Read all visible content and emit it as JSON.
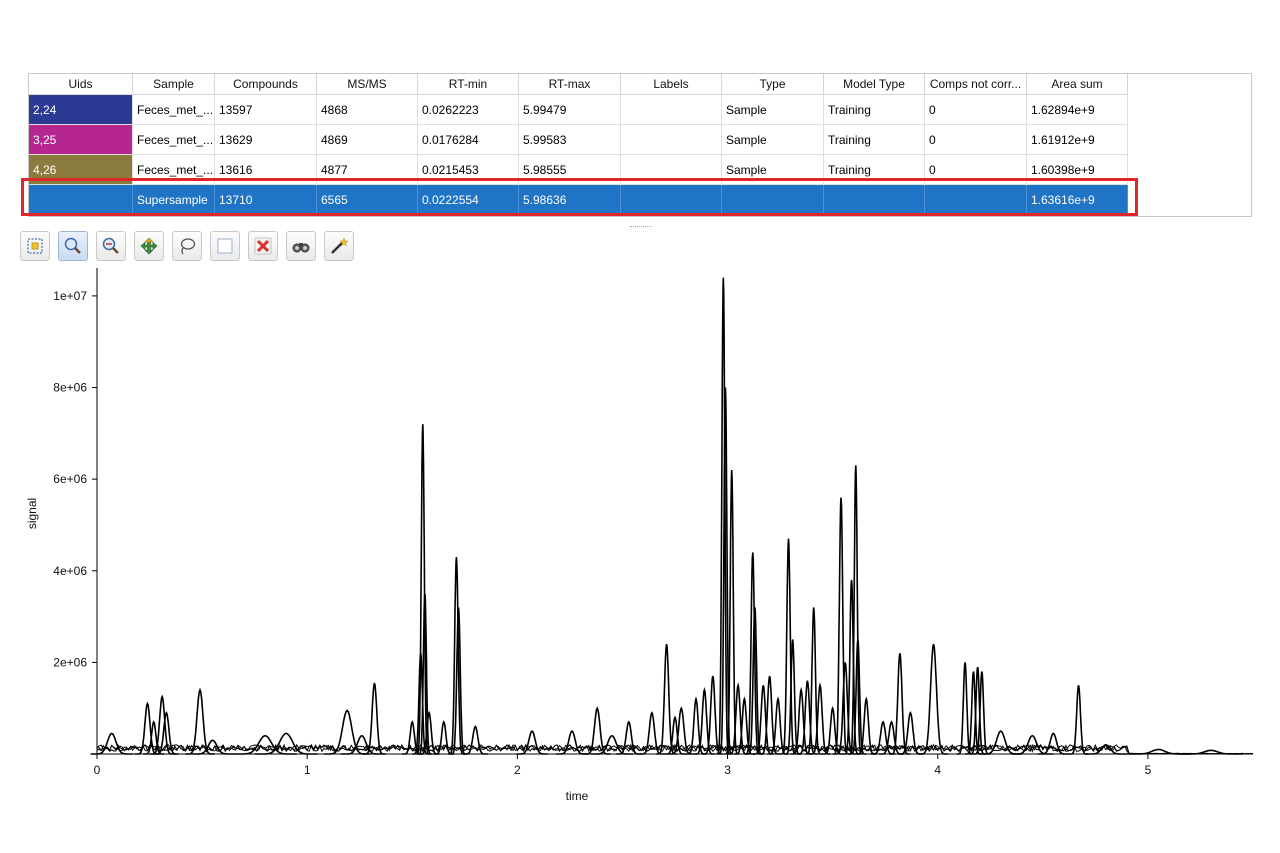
{
  "table": {
    "columns": [
      "Uids",
      "Sample",
      "Compounds",
      "MS/MS",
      "RT-min",
      "RT-max",
      "Labels",
      "Type",
      "Model Type",
      "Comps not corr...",
      "Area sum"
    ],
    "rows": [
      {
        "uids": "2,24",
        "color": "#2b3a93",
        "sample": "Feces_met_...",
        "compounds": "13597",
        "msms": "4868",
        "rt_min": "0.0262223",
        "rt_max": "5.99479",
        "labels": "",
        "type": "Sample",
        "model_type": "Training",
        "comps_not_corr": "0",
        "area_sum": "1.62894e+9"
      },
      {
        "uids": "3,25",
        "color": "#b5268f",
        "sample": "Feces_met_...",
        "compounds": "13629",
        "msms": "4869",
        "rt_min": "0.0176284",
        "rt_max": "5.99583",
        "labels": "",
        "type": "Sample",
        "model_type": "Training",
        "comps_not_corr": "0",
        "area_sum": "1.61912e+9"
      },
      {
        "uids": "4,26",
        "color": "#8b7b3c",
        "sample": "Feces_met_...",
        "compounds": "13616",
        "msms": "4877",
        "rt_min": "0.0215453",
        "rt_max": "5.98555",
        "labels": "",
        "type": "Sample",
        "model_type": "Training",
        "comps_not_corr": "0",
        "area_sum": "1.60398e+9"
      },
      {
        "uids": "",
        "color": "#1f74c6",
        "sample": "Supersample",
        "compounds": "13710",
        "msms": "6565",
        "rt_min": "0.0222554",
        "rt_max": "5.98636",
        "labels": "",
        "type": "",
        "model_type": "",
        "comps_not_corr": "",
        "area_sum": "1.63616e+9",
        "selected": true
      }
    ],
    "highlight_color": "#e0252b",
    "selection_color": "#1f74c6"
  },
  "toolbar": {
    "tools": [
      "select-box-icon",
      "zoom-in-icon",
      "zoom-out-icon",
      "pan-icon",
      "lasso-icon",
      "empty-square-icon",
      "delete-icon",
      "binoculars-icon",
      "magic-wand-icon"
    ]
  },
  "chart_data": {
    "type": "line",
    "xlabel": "time",
    "ylabel": "signal",
    "xlim": [
      0,
      5.5
    ],
    "ylim": [
      0,
      10500000
    ],
    "x_ticks": [
      "0",
      "1",
      "2",
      "3",
      "4",
      "5"
    ],
    "y_ticks": [
      "2e+06",
      "4e+06",
      "6e+06",
      "8e+06",
      "1e+07"
    ],
    "line_color": "#000000",
    "peaks": [
      {
        "rt": 0.07,
        "h": 450000,
        "w": 0.02
      },
      {
        "rt": 0.24,
        "h": 1100000,
        "w": 0.012
      },
      {
        "rt": 0.27,
        "h": 700000,
        "w": 0.01
      },
      {
        "rt": 0.31,
        "h": 1250000,
        "w": 0.012
      },
      {
        "rt": 0.33,
        "h": 900000,
        "w": 0.012
      },
      {
        "rt": 0.49,
        "h": 1400000,
        "w": 0.014
      },
      {
        "rt": 0.55,
        "h": 300000,
        "w": 0.02
      },
      {
        "rt": 0.8,
        "h": 400000,
        "w": 0.03
      },
      {
        "rt": 0.9,
        "h": 450000,
        "w": 0.03
      },
      {
        "rt": 1.19,
        "h": 950000,
        "w": 0.022
      },
      {
        "rt": 1.26,
        "h": 400000,
        "w": 0.02
      },
      {
        "rt": 1.32,
        "h": 1550000,
        "w": 0.011
      },
      {
        "rt": 1.5,
        "h": 700000,
        "w": 0.01
      },
      {
        "rt": 1.54,
        "h": 2200000,
        "w": 0.008
      },
      {
        "rt": 1.55,
        "h": 7200000,
        "w": 0.007
      },
      {
        "rt": 1.56,
        "h": 3500000,
        "w": 0.007
      },
      {
        "rt": 1.58,
        "h": 900000,
        "w": 0.01
      },
      {
        "rt": 1.65,
        "h": 700000,
        "w": 0.01
      },
      {
        "rt": 1.71,
        "h": 4300000,
        "w": 0.008
      },
      {
        "rt": 1.72,
        "h": 3200000,
        "w": 0.008
      },
      {
        "rt": 1.8,
        "h": 600000,
        "w": 0.012
      },
      {
        "rt": 2.07,
        "h": 500000,
        "w": 0.015
      },
      {
        "rt": 2.26,
        "h": 500000,
        "w": 0.015
      },
      {
        "rt": 2.38,
        "h": 1000000,
        "w": 0.013
      },
      {
        "rt": 2.45,
        "h": 400000,
        "w": 0.02
      },
      {
        "rt": 2.53,
        "h": 700000,
        "w": 0.012
      },
      {
        "rt": 2.64,
        "h": 900000,
        "w": 0.012
      },
      {
        "rt": 2.71,
        "h": 2400000,
        "w": 0.01
      },
      {
        "rt": 2.75,
        "h": 800000,
        "w": 0.01
      },
      {
        "rt": 2.78,
        "h": 1000000,
        "w": 0.012
      },
      {
        "rt": 2.85,
        "h": 1200000,
        "w": 0.01
      },
      {
        "rt": 2.89,
        "h": 1400000,
        "w": 0.01
      },
      {
        "rt": 2.93,
        "h": 1700000,
        "w": 0.01
      },
      {
        "rt": 2.98,
        "h": 10400000,
        "w": 0.007
      },
      {
        "rt": 2.99,
        "h": 8000000,
        "w": 0.007
      },
      {
        "rt": 3.02,
        "h": 6200000,
        "w": 0.007
      },
      {
        "rt": 3.05,
        "h": 1500000,
        "w": 0.01
      },
      {
        "rt": 3.08,
        "h": 1200000,
        "w": 0.01
      },
      {
        "rt": 3.12,
        "h": 4400000,
        "w": 0.008
      },
      {
        "rt": 3.13,
        "h": 3200000,
        "w": 0.008
      },
      {
        "rt": 3.17,
        "h": 1500000,
        "w": 0.01
      },
      {
        "rt": 3.2,
        "h": 1700000,
        "w": 0.01
      },
      {
        "rt": 3.24,
        "h": 1200000,
        "w": 0.01
      },
      {
        "rt": 3.29,
        "h": 4700000,
        "w": 0.008
      },
      {
        "rt": 3.31,
        "h": 2500000,
        "w": 0.008
      },
      {
        "rt": 3.35,
        "h": 1400000,
        "w": 0.01
      },
      {
        "rt": 3.38,
        "h": 1600000,
        "w": 0.01
      },
      {
        "rt": 3.41,
        "h": 3200000,
        "w": 0.008
      },
      {
        "rt": 3.44,
        "h": 1500000,
        "w": 0.01
      },
      {
        "rt": 3.5,
        "h": 1000000,
        "w": 0.01
      },
      {
        "rt": 3.54,
        "h": 5600000,
        "w": 0.008
      },
      {
        "rt": 3.56,
        "h": 2000000,
        "w": 0.01
      },
      {
        "rt": 3.59,
        "h": 3800000,
        "w": 0.008
      },
      {
        "rt": 3.61,
        "h": 6300000,
        "w": 0.007
      },
      {
        "rt": 3.62,
        "h": 2500000,
        "w": 0.008
      },
      {
        "rt": 3.66,
        "h": 1200000,
        "w": 0.01
      },
      {
        "rt": 3.74,
        "h": 700000,
        "w": 0.012
      },
      {
        "rt": 3.78,
        "h": 700000,
        "w": 0.012
      },
      {
        "rt": 3.82,
        "h": 2200000,
        "w": 0.01
      },
      {
        "rt": 3.87,
        "h": 900000,
        "w": 0.012
      },
      {
        "rt": 3.98,
        "h": 2400000,
        "w": 0.014
      },
      {
        "rt": 4.13,
        "h": 2000000,
        "w": 0.008
      },
      {
        "rt": 4.17,
        "h": 1800000,
        "w": 0.008
      },
      {
        "rt": 4.19,
        "h": 1900000,
        "w": 0.008
      },
      {
        "rt": 4.21,
        "h": 1800000,
        "w": 0.008
      },
      {
        "rt": 4.3,
        "h": 500000,
        "w": 0.02
      },
      {
        "rt": 4.45,
        "h": 400000,
        "w": 0.02
      },
      {
        "rt": 4.55,
        "h": 450000,
        "w": 0.015
      },
      {
        "rt": 4.67,
        "h": 1500000,
        "w": 0.009
      },
      {
        "rt": 4.8,
        "h": 200000,
        "w": 0.02
      },
      {
        "rt": 5.05,
        "h": 100000,
        "w": 0.03
      },
      {
        "rt": 5.3,
        "h": 80000,
        "w": 0.03
      }
    ]
  }
}
